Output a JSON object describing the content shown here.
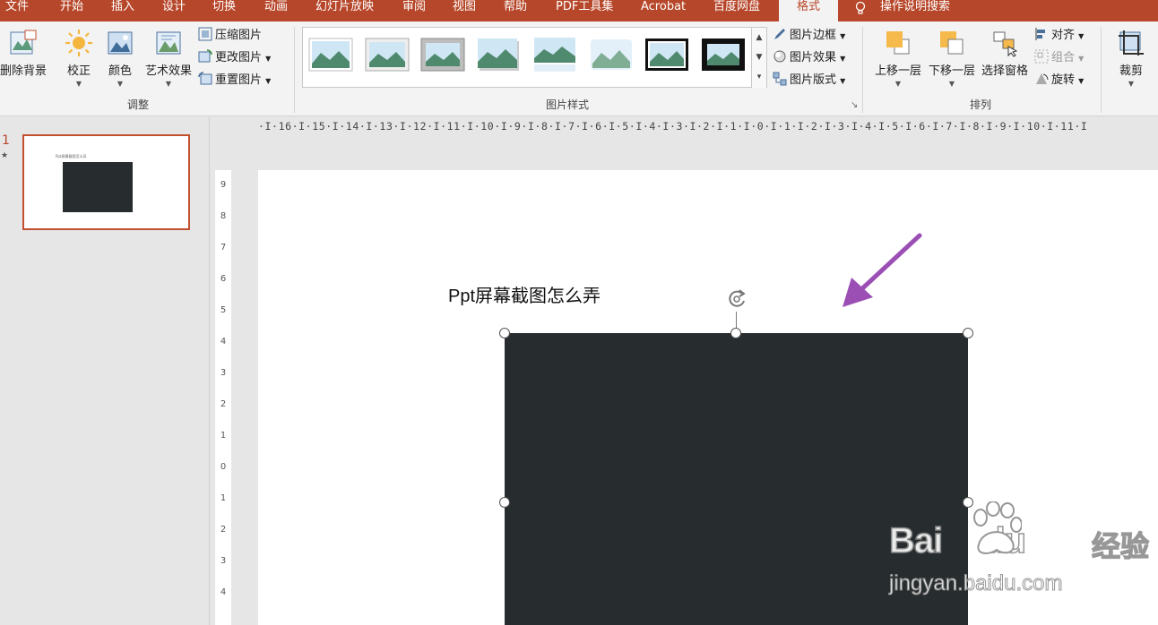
{
  "menu_tabs": [
    "文件",
    "开始",
    "插入",
    "设计",
    "切换",
    "动画",
    "幻灯片放映",
    "审阅",
    "视图",
    "帮助",
    "PDF工具集",
    "Acrobat",
    "百度网盘"
  ],
  "active_tab": "格式",
  "tell_me": "操作说明搜索",
  "ribbon": {
    "adjust": {
      "group_label": "调整",
      "remove_bg": "删除背景",
      "corrections": "校正",
      "color": "颜色",
      "artistic": "艺术效果",
      "compress": "压缩图片",
      "change": "更改图片",
      "reset": "重置图片"
    },
    "styles": {
      "group_label": "图片样式",
      "border": "图片边框",
      "effects": "图片效果",
      "layout": "图片版式"
    },
    "arrange": {
      "group_label": "排列",
      "bring_forward": "上移一层",
      "send_backward": "下移一层",
      "selection_pane": "选择窗格",
      "align": "对齐",
      "group": "组合",
      "rotate": "旋转"
    },
    "size": {
      "crop": "裁剪"
    }
  },
  "ruler_h": "·I·16·I·15·I·14·I·13·I·12·I·11·I·10·I·9·I·8·I·7·I·6·I·5·I·4·I·3·I·2·I·1·I·0·I·1·I·2·I·3·I·4·I·5·I·6·I·7·I·8·I·9·I·10·I·11·I",
  "ruler_v": [
    "9",
    "8",
    "7",
    "6",
    "5",
    "4",
    "3",
    "2",
    "1",
    "0",
    "1",
    "2",
    "3",
    "4"
  ],
  "slides": {
    "number": "1",
    "star": "★",
    "thumb_title": "Ppt屏幕截图怎么弄"
  },
  "slide": {
    "title": "Ppt屏幕截图怎么弄",
    "picture_color": "#272c2e"
  },
  "watermark": {
    "brand_bai": "Bai",
    "brand_du": "du",
    "brand_jingyan": "经验",
    "url": "jingyan.baidu.com"
  },
  "colors": {
    "accent": "#b7472a",
    "arrow": "#9b4fb5"
  }
}
